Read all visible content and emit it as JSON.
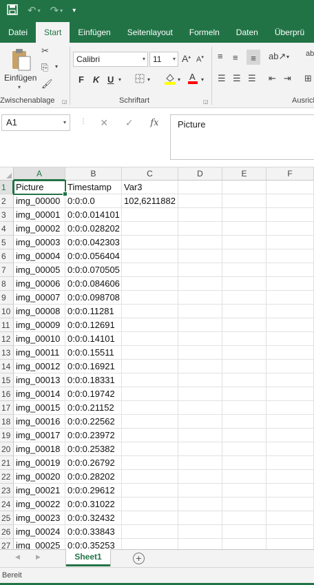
{
  "quick_access": {
    "save_icon": "save-icon",
    "undo_icon": "undo-icon",
    "redo_icon": "redo-icon",
    "customize_icon": "customize-qat-icon"
  },
  "ribbon_tabs": [
    {
      "label": "Datei",
      "active": false
    },
    {
      "label": "Start",
      "active": true
    },
    {
      "label": "Einfügen",
      "active": false
    },
    {
      "label": "Seitenlayout",
      "active": false
    },
    {
      "label": "Formeln",
      "active": false
    },
    {
      "label": "Daten",
      "active": false
    },
    {
      "label": "Überprü",
      "active": false
    }
  ],
  "ribbon": {
    "clipboard": {
      "paste_label": "Einfügen",
      "group_label": "Zwischenablage"
    },
    "font": {
      "name": "Calibri",
      "size": "11",
      "group_label": "Schriftart",
      "bold": "F",
      "italic": "K",
      "underline": "U"
    },
    "alignment": {
      "group_label": "Ausrich"
    },
    "colors": {
      "accent": "#217346",
      "highlight": "#ffff00",
      "font_color": "#ff0000"
    }
  },
  "formula_bar": {
    "name_box": "A1",
    "content": "Picture",
    "cancel": "✕",
    "enter": "✓",
    "fx": "fx"
  },
  "columns": [
    "A",
    "B",
    "C",
    "D",
    "E",
    "F"
  ],
  "rows": [
    {
      "num": "1",
      "a": "Picture",
      "b": "Timestamp",
      "c": "Var3"
    },
    {
      "num": "2",
      "a": "img_00000",
      "b": "0:0:0.0",
      "c": " 102,6211882"
    },
    {
      "num": "3",
      "a": "img_00001",
      "b": "0:0:0.014101",
      "c": ""
    },
    {
      "num": "4",
      "a": "img_00002",
      "b": "0:0:0.028202",
      "c": ""
    },
    {
      "num": "5",
      "a": "img_00003",
      "b": "0:0:0.042303",
      "c": ""
    },
    {
      "num": "6",
      "a": "img_00004",
      "b": "0:0:0.056404",
      "c": ""
    },
    {
      "num": "7",
      "a": "img_00005",
      "b": "0:0:0.070505",
      "c": ""
    },
    {
      "num": "8",
      "a": "img_00006",
      "b": "0:0:0.084606",
      "c": ""
    },
    {
      "num": "9",
      "a": "img_00007",
      "b": "0:0:0.098708",
      "c": ""
    },
    {
      "num": "10",
      "a": "img_00008",
      "b": "0:0:0.11281",
      "c": ""
    },
    {
      "num": "11",
      "a": "img_00009",
      "b": "0:0:0.12691",
      "c": ""
    },
    {
      "num": "12",
      "a": "img_00010",
      "b": "0:0:0.14101",
      "c": ""
    },
    {
      "num": "13",
      "a": "img_00011",
      "b": "0:0:0.15511",
      "c": ""
    },
    {
      "num": "14",
      "a": "img_00012",
      "b": "0:0:0.16921",
      "c": ""
    },
    {
      "num": "15",
      "a": "img_00013",
      "b": "0:0:0.18331",
      "c": ""
    },
    {
      "num": "16",
      "a": "img_00014",
      "b": "0:0:0.19742",
      "c": ""
    },
    {
      "num": "17",
      "a": "img_00015",
      "b": "0:0:0.21152",
      "c": ""
    },
    {
      "num": "18",
      "a": "img_00016",
      "b": "0:0:0.22562",
      "c": ""
    },
    {
      "num": "19",
      "a": "img_00017",
      "b": "0:0:0.23972",
      "c": ""
    },
    {
      "num": "20",
      "a": "img_00018",
      "b": "0:0:0.25382",
      "c": ""
    },
    {
      "num": "21",
      "a": "img_00019",
      "b": "0:0:0.26792",
      "c": ""
    },
    {
      "num": "22",
      "a": "img_00020",
      "b": "0:0:0.28202",
      "c": ""
    },
    {
      "num": "23",
      "a": "img_00021",
      "b": "0:0:0.29612",
      "c": ""
    },
    {
      "num": "24",
      "a": "img_00022",
      "b": "0:0:0.31022",
      "c": ""
    },
    {
      "num": "25",
      "a": "img_00023",
      "b": "0:0:0.32432",
      "c": ""
    },
    {
      "num": "26",
      "a": "img_00024",
      "b": "0:0:0.33843",
      "c": ""
    },
    {
      "num": "27",
      "a": "img_00025",
      "b": "0:0:0.35253",
      "c": ""
    }
  ],
  "sheet_tabs": [
    {
      "label": "Sheet1",
      "active": true
    }
  ],
  "status": {
    "text": "Bereit"
  }
}
